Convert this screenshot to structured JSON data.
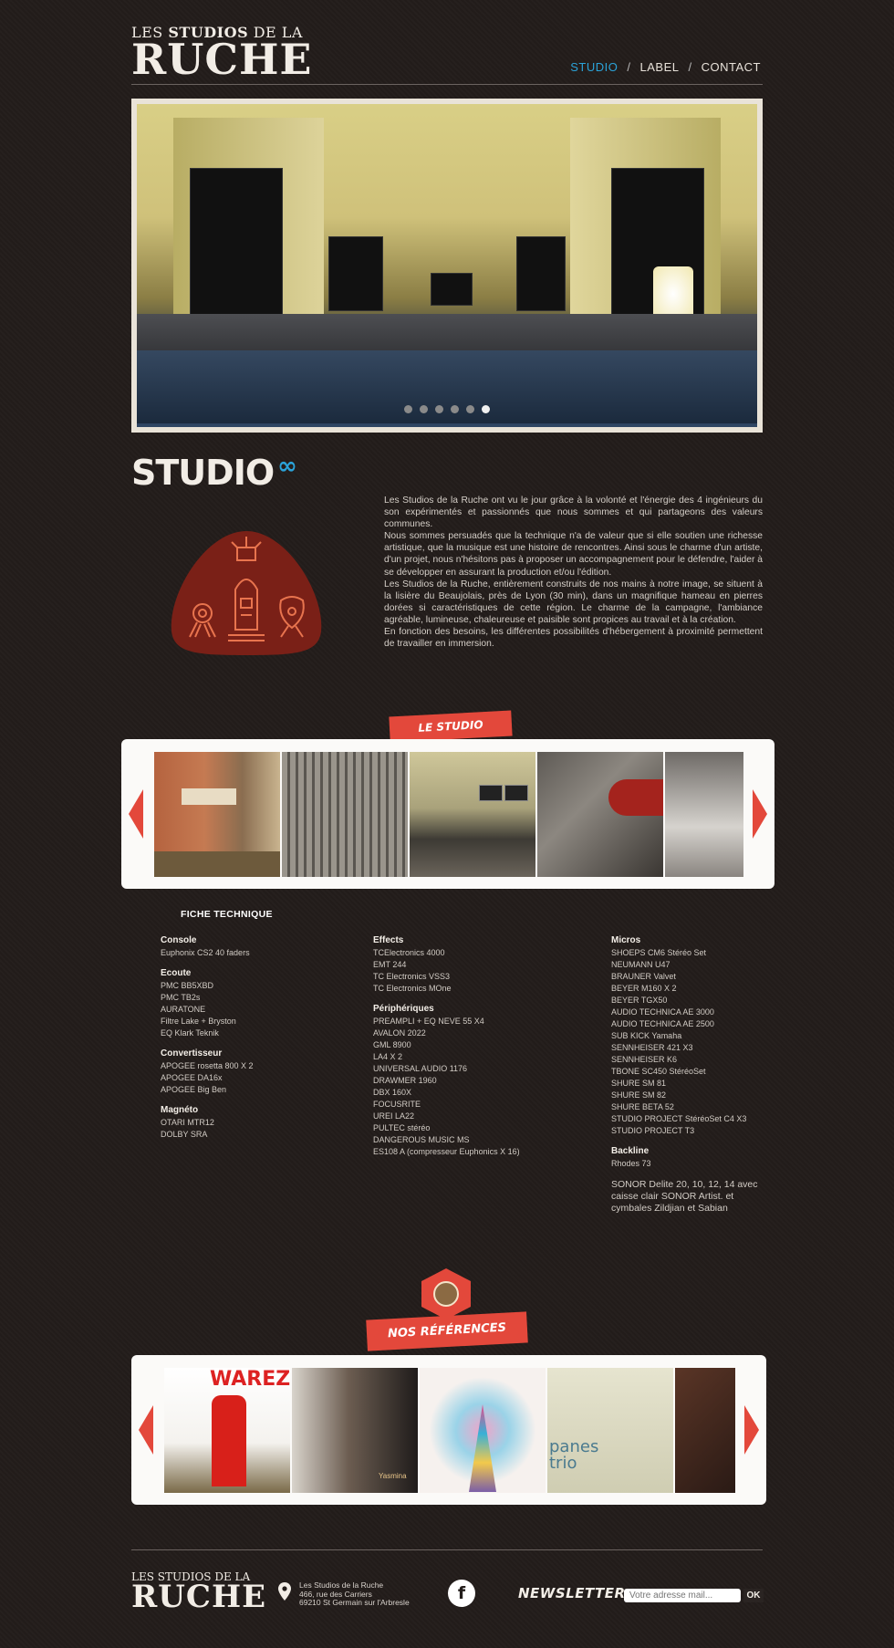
{
  "header": {
    "logo_small_prefix": "LES ",
    "logo_small_bold": "STUDIOS",
    "logo_small_suffix": " DE LA",
    "logo_big": "RUCHE",
    "nav": [
      {
        "label": "STUDIO",
        "active": true
      },
      {
        "label": "LABEL",
        "active": false
      },
      {
        "label": "CONTACT",
        "active": false
      }
    ],
    "nav_separator": "/"
  },
  "hero": {
    "slide_count": 6,
    "active_slide": 6
  },
  "studio": {
    "heading": "STUDIO",
    "heading_icon": "infinity-icon",
    "paragraphs": [
      "Les Studios de la Ruche ont vu le jour grâce à la volonté et l'énergie des 4 ingénieurs du son expérimentés et passionnés que nous sommes et qui partageons des valeurs communes.",
      "Nous sommes persuadés que la technique n'a de valeur que si elle soutien une richesse artistique, que la musique est une histoire de rencontres. Ainsi sous le charme d'un artiste, d'un projet, nous n'hésitons pas à proposer un accompagnement pour le défendre, l'aider à se développer en assurant la production et/ou l'édition.",
      "Les Studios de la Ruche, entièrement construits de nos mains à notre image, se situent à la lisière du Beaujolais, près de Lyon (30 min), dans un magnifique hameau en pierres dorées si caractéristiques de cette région. Le charme de la campagne, l'ambiance agréable, lumineuse, chaleureuse et paisible sont propices au travail et à la création.",
      "En fonction des besoins, les différentes possibilités d'hébergement à proximité permettent de travailler en immersion."
    ]
  },
  "le_studio": {
    "ribbon": "LE STUDIO"
  },
  "fiche": {
    "title": "FICHE TECHNIQUE",
    "col1": [
      {
        "title": "Console",
        "items": [
          "Euphonix CS2 40 faders"
        ]
      },
      {
        "title": "Ecoute",
        "items": [
          "PMC BB5XBD",
          "PMC TB2s",
          "AURATONE",
          "Filtre Lake + Bryston",
          "EQ Klark Teknik"
        ]
      },
      {
        "title": "Convertisseur",
        "items": [
          "APOGEE rosetta 800 X 2",
          "APOGEE DA16x",
          "APOGEE Big Ben"
        ]
      },
      {
        "title": "Magnéto",
        "items": [
          "OTARI MTR12",
          "DOLBY SRA"
        ]
      }
    ],
    "col2": [
      {
        "title": "Effects",
        "items": [
          "TCElectronics 4000",
          "EMT 244",
          "TC Electronics VSS3",
          "TC Electronics MOne"
        ]
      },
      {
        "title": "Périphériques",
        "items": [
          "PREAMPLI + EQ NEVE 55 X4",
          "AVALON 2022",
          "GML 8900",
          "LA4 X 2",
          "UNIVERSAL AUDIO 1176",
          "DRAWMER 1960",
          "DBX 160X",
          "FOCUSRITE",
          "UREI LA22",
          "PULTEC stéréo",
          "DANGEROUS MUSIC MS",
          "ES108 A (compresseur Euphonics X 16)"
        ]
      }
    ],
    "col3": [
      {
        "title": "Micros",
        "items": [
          "SHOEPS CM6 Stéréo Set",
          "NEUMANN U47",
          "BRAUNER Valvet",
          "BEYER M160 X 2",
          "BEYER TGX50",
          "AUDIO TECHNICA AE 3000",
          "AUDIO TECHNICA AE 2500",
          "SUB KICK Yamaha",
          "SENNHEISER 421 X3",
          "SENNHEISER K6",
          "TBONE SC450 StéréoSet",
          "SHURE SM 81",
          "SHURE SM 82",
          "SHURE BETA 52",
          "STUDIO PROJECT StéréoSet C4 X3",
          "STUDIO PROJECT T3"
        ]
      },
      {
        "title": "Backline",
        "items": [
          "Rhodes 73"
        ]
      }
    ],
    "col3_extra": "SONOR Delite 20, 10, 12, 14  avec caisse clair SONOR Artist. et cymbales Zildjian et Sabian"
  },
  "references": {
    "ribbon": "NOS RÉFÉRENCES",
    "badge_icon": "vinyl-record-icon",
    "album_texts": [
      "WAREZ",
      "Yasmina",
      "panes",
      "trio"
    ]
  },
  "footer": {
    "logo_small": "LES STUDIOS DE LA",
    "logo_big": "RUCHE",
    "address": [
      "Les Studios de la Ruche",
      "466, rue des Carriers",
      "69210 St Germain sur l'Arbresle"
    ],
    "facebook_letter": "f",
    "newsletter_label": "NEWSLETTER",
    "newsletter_placeholder": "Votre adresse mail...",
    "ok_label": "OK"
  },
  "colors": {
    "background": "#231d1b",
    "accent_blue": "#2ba3d9",
    "accent_red": "#e3483b",
    "emblem_red": "#7a2017"
  }
}
